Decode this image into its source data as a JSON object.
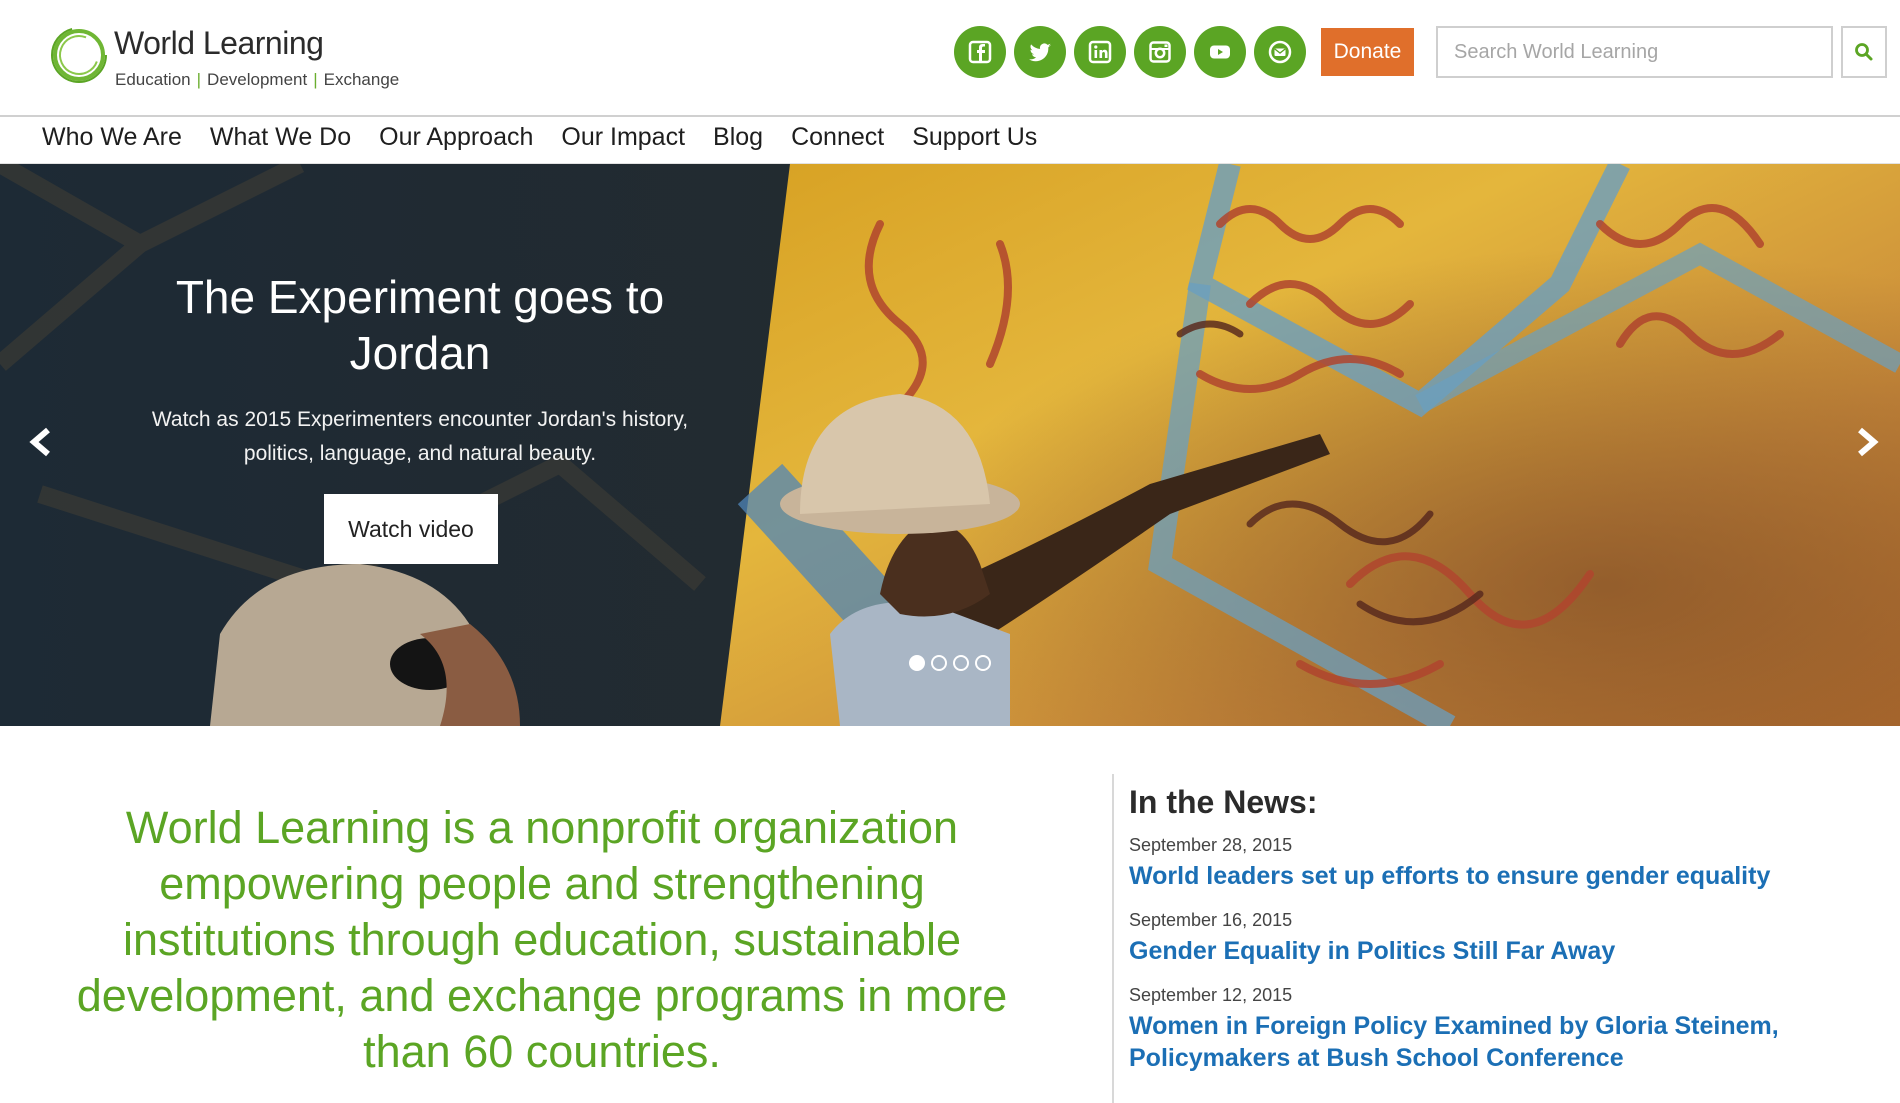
{
  "header": {
    "logo_name": "World Learning",
    "tagline": [
      "Education",
      "Development",
      "Exchange"
    ],
    "tagline_separator": "|",
    "social_icons": [
      "facebook-icon",
      "twitter-icon",
      "linkedin-icon",
      "instagram-icon",
      "youtube-icon",
      "email-icon"
    ],
    "donate_label": "Donate",
    "search_placeholder": "Search World Learning"
  },
  "nav": {
    "items": [
      "Who We Are",
      "What We Do",
      "Our Approach",
      "Our Impact",
      "Blog",
      "Connect",
      "Support Us"
    ]
  },
  "hero": {
    "title": "The Experiment goes to Jordan",
    "subtitle": "Watch as 2015 Experimenters encounter Jordan's history, politics, language, and natural beauty.",
    "cta_label": "Watch video",
    "slide_count": 4,
    "active_slide": 1
  },
  "mission": {
    "text": "World Learning is a nonprofit organization empowering people and strengthening institutions through education, sustainable development, and exchange programs in more than 60 countries."
  },
  "news": {
    "heading": "In the News:",
    "items": [
      {
        "date": "September 28, 2015",
        "title": "World leaders set up efforts to ensure gender equality"
      },
      {
        "date": "September 16, 2015",
        "title": "Gender Equality in Politics Still Far Away"
      },
      {
        "date": "September 12, 2015",
        "title": "Women in Foreign Policy Examined by Gloria Steinem, Policymakers at Bush School Conference"
      }
    ]
  },
  "colors": {
    "brand_green": "#5ba524",
    "donate_orange": "#e06f2b",
    "link_blue": "#1b6fb5"
  }
}
